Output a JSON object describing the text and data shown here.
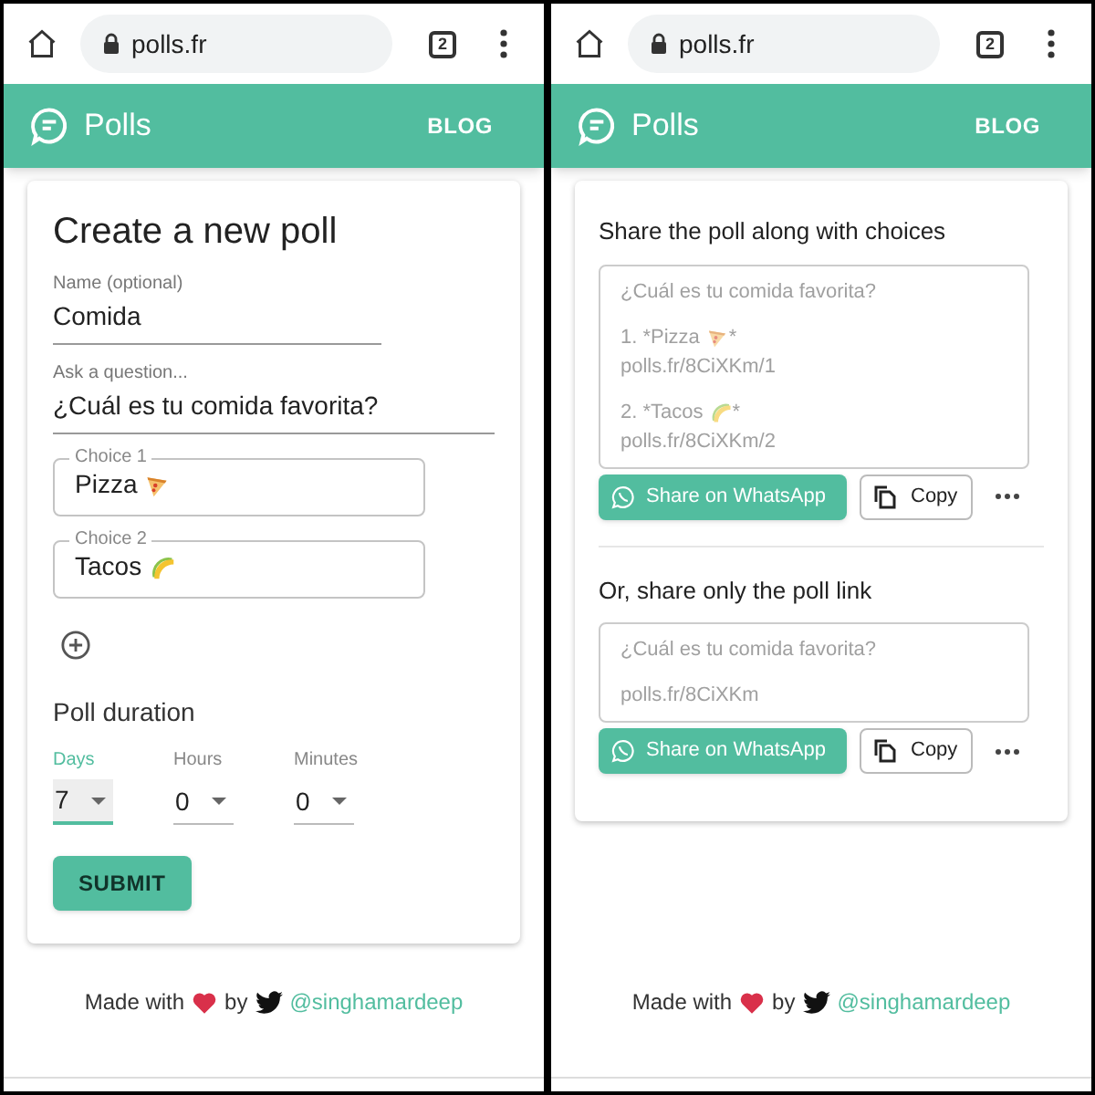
{
  "screens": [
    {
      "kind": "create",
      "browser": {
        "url": "polls.fr",
        "tab_count": "2"
      },
      "app_bar": {
        "title": "Polls",
        "link": "BLOG"
      },
      "form": {
        "title": "Create a new poll",
        "name": {
          "label": "Name (optional)",
          "value": "Comida"
        },
        "question": {
          "label": "Ask a question...",
          "value": "¿Cuál es tu comida favorita?"
        },
        "choices": [
          {
            "label": "Choice 1",
            "value": "Pizza",
            "kind": "pizza"
          },
          {
            "label": "Choice 2",
            "value": "Tacos",
            "kind": "taco"
          }
        ],
        "duration": {
          "title": "Poll duration",
          "fields": [
            {
              "label": "Days",
              "value": "7",
              "focused": true
            },
            {
              "label": "Hours",
              "value": "0",
              "focused": false
            },
            {
              "label": "Minutes",
              "value": "0",
              "focused": false
            }
          ]
        },
        "submit": "SUBMIT"
      },
      "footer": {
        "before": "Made with",
        "middle": "by",
        "handle": "@singhamardeep"
      }
    },
    {
      "kind": "share",
      "browser": {
        "url": "polls.fr",
        "tab_count": "2"
      },
      "app_bar": {
        "title": "Polls",
        "link": "BLOG"
      },
      "sections": [
        {
          "title": "Share the poll along with choices",
          "blocks": [
            [
              {
                "text": "¿Cuál es tu comida favorita?"
              }
            ],
            [
              {
                "text": "1. *Pizza",
                "kind": "pizza",
                "after": "*"
              },
              {
                "text": "polls.fr/8CiXKm/1"
              }
            ],
            [
              {
                "text": "2. *Tacos",
                "kind": "taco",
                "after": "*"
              },
              {
                "text": "polls.fr/8CiXKm/2"
              }
            ]
          ],
          "share_button": "Share on WhatsApp",
          "copy_button": "Copy"
        },
        {
          "title": "Or, share only the poll link",
          "blocks": [
            [
              {
                "text": "¿Cuál es tu comida favorita?"
              }
            ],
            [
              {
                "text": "polls.fr/8CiXKm"
              }
            ]
          ],
          "share_button": "Share on WhatsApp",
          "copy_button": "Copy"
        }
      ],
      "footer": {
        "before": "Made with",
        "middle": "by",
        "handle": "@singhamardeep"
      }
    }
  ]
}
